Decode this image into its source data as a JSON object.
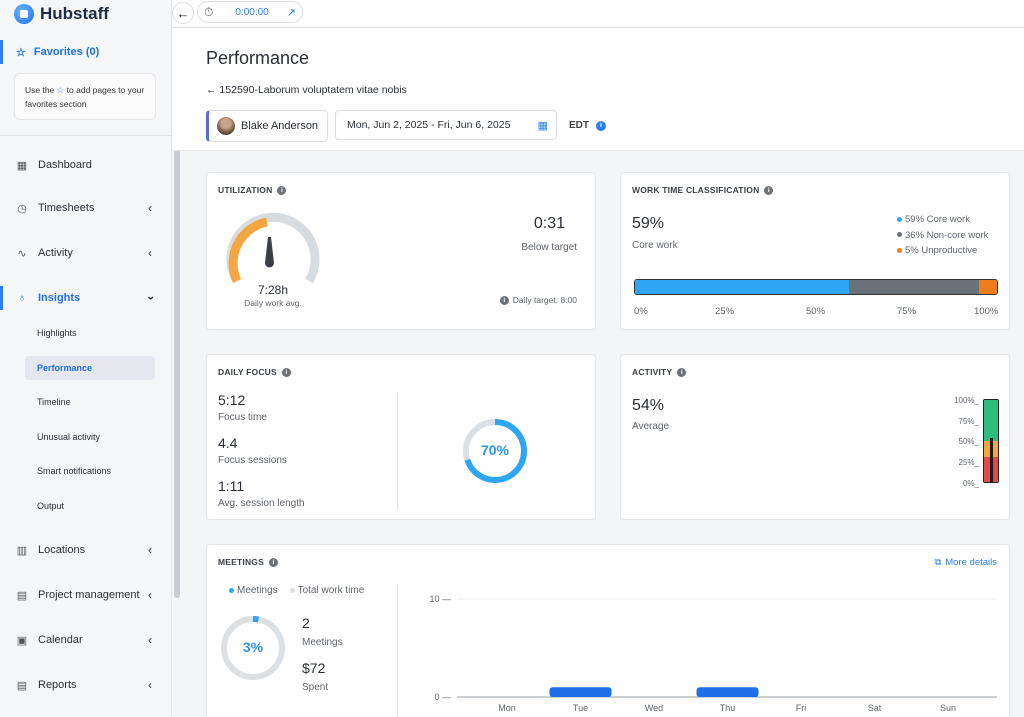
{
  "brand": {
    "name": "Hubstaff"
  },
  "topbar": {
    "timer_value": "0:00:00"
  },
  "sidebar": {
    "favorites_label": "Favorites (0)",
    "favorites_hint_pre": "Use the",
    "favorites_hint_post": "to add pages to your favorites section",
    "items": [
      {
        "label": "Dashboard",
        "icon": "dashboard-icon"
      },
      {
        "label": "Timesheets",
        "icon": "clock-icon"
      },
      {
        "label": "Activity",
        "icon": "activity-icon"
      },
      {
        "label": "Insights",
        "icon": "lightbulb-icon"
      },
      {
        "label": "Locations",
        "icon": "map-icon"
      },
      {
        "label": "Project management",
        "icon": "project-icon"
      },
      {
        "label": "Calendar",
        "icon": "calendar-icon"
      },
      {
        "label": "Reports",
        "icon": "report-icon"
      }
    ],
    "insights_sub": [
      "Highlights",
      "Performance",
      "Timeline",
      "Unusual activity",
      "Smart notifications",
      "Output"
    ]
  },
  "header": {
    "title": "Performance",
    "breadcrumb": "152590-Laborum voluptatem vitae nobis",
    "user": "Blake Anderson",
    "date_range": "Mon, Jun 2, 2025 - Fri, Jun 6, 2025",
    "timezone": "EDT"
  },
  "utilization": {
    "title": "UTILIZATION",
    "gauge_value": "7:28h",
    "gauge_label": "Daily work avg.",
    "delta": "0:31",
    "delta_label": "Below target",
    "target_label": "Daily target: 8:00",
    "fraction_of_target": 0.93
  },
  "work_time": {
    "title": "WORK TIME CLASSIFICATION",
    "headline": "59%",
    "headline_label": "Core work",
    "legend": [
      "59% Core work",
      "36% Non-core work",
      "5% Unproductive"
    ],
    "segments": [
      59,
      36,
      5
    ],
    "colors": [
      "#2fa5f5",
      "#6b7178",
      "#f07c1b"
    ],
    "ticks": [
      "0%",
      "25%",
      "50%",
      "75%",
      "100%"
    ]
  },
  "daily_focus": {
    "title": "DAILY FOCUS",
    "focus_time": "5:12",
    "focus_time_label": "Focus time",
    "sessions": "4.4",
    "sessions_label": "Focus sessions",
    "avg_len": "1:11",
    "avg_len_label": "Avg. session length",
    "ring_value": "70%",
    "ring_fraction": 0.7
  },
  "activity": {
    "title": "ACTIVITY",
    "value": "54%",
    "value_label": "Average",
    "ticks": [
      "100%_",
      "75%_",
      "50%_",
      "25%_",
      "0%_"
    ],
    "fraction": 0.54
  },
  "meetings": {
    "title": "MEETINGS",
    "more_details": "More details",
    "legend": [
      "Meetings",
      "Total work time"
    ],
    "ring_value": "3%",
    "ring_fraction": 0.03,
    "count": "2",
    "count_label": "Meetings",
    "spent": "$72",
    "spent_label": "Spent"
  },
  "chart_data": {
    "type": "bar",
    "categories": [
      "Mon",
      "Tue",
      "Wed",
      "Thu",
      "Fri",
      "Sat",
      "Sun"
    ],
    "values": [
      0,
      1,
      0,
      1,
      0,
      0,
      0
    ],
    "ylim": [
      0,
      10
    ],
    "yticks": [
      "10 —",
      "0 —"
    ]
  }
}
